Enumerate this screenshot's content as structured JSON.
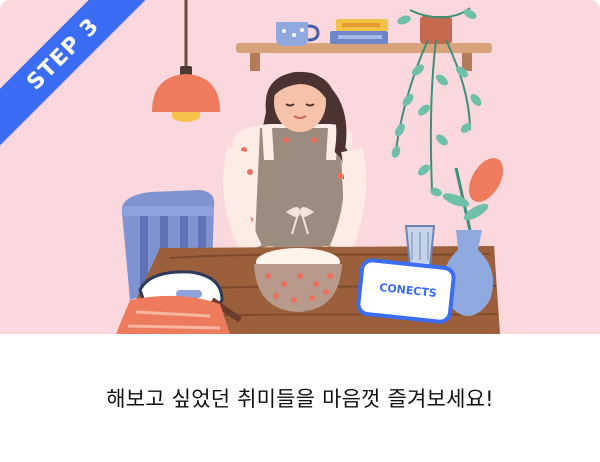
{
  "step_badge": {
    "label": "STEP 3"
  },
  "phone_brand": {
    "label": "CONECTS"
  },
  "caption": {
    "text": "해보고 싶었던 취미들을 마음껏 즐겨보세요!"
  },
  "colors": {
    "background": "#fbd8dd",
    "badge": "#3a6cf4",
    "caption_text": "#111111"
  }
}
